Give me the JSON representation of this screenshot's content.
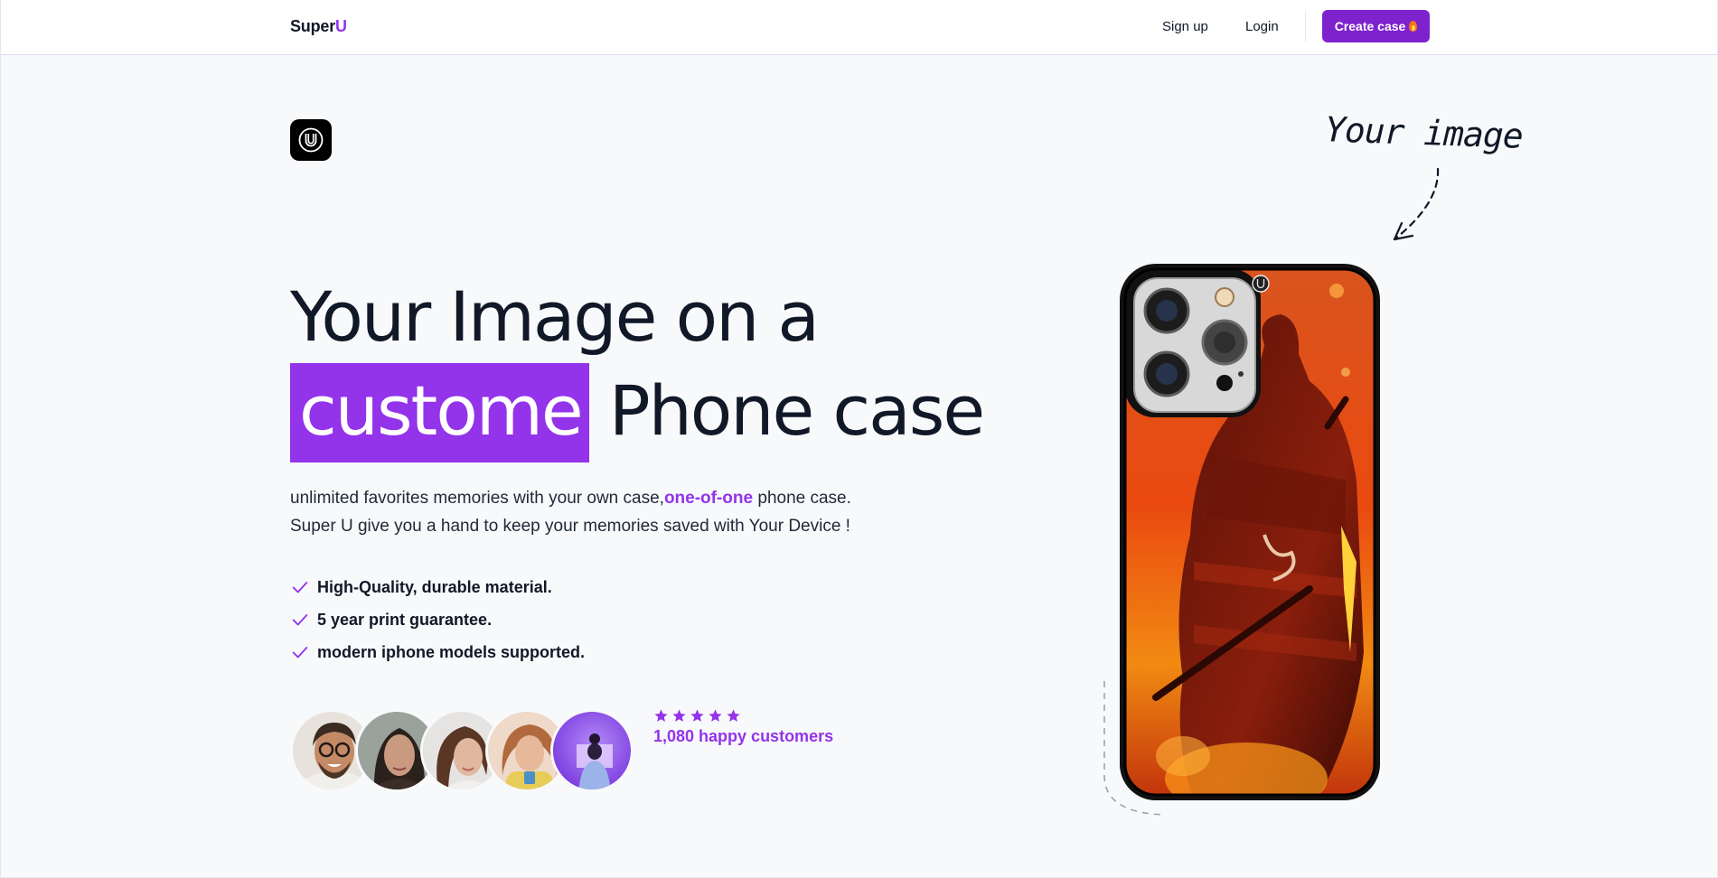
{
  "nav": {
    "brand_main": "Super",
    "brand_accent": "U",
    "signup": "Sign up",
    "login": "Login",
    "cta": "Create case"
  },
  "hero": {
    "title_line1": "Your Image on a",
    "title_highlight": "custome",
    "title_rest": "Phone case",
    "lead_part1": "unlimited favorites memories with your own case,",
    "lead_em": "one-of-one",
    "lead_part2": " phone case.",
    "lead_line2": "Super U give you a hand to keep your memories saved with Your Device !",
    "features": [
      "High-Quality, durable material.",
      "5 year print guarantee.",
      "modern iphone models supported."
    ],
    "rating": 5,
    "customers": "1,080 happy customers"
  },
  "annotation": {
    "your_image": "Your image"
  },
  "colors": {
    "accent": "#9333ea",
    "cta": "#7e22ce",
    "background": "#f8f9fb"
  }
}
